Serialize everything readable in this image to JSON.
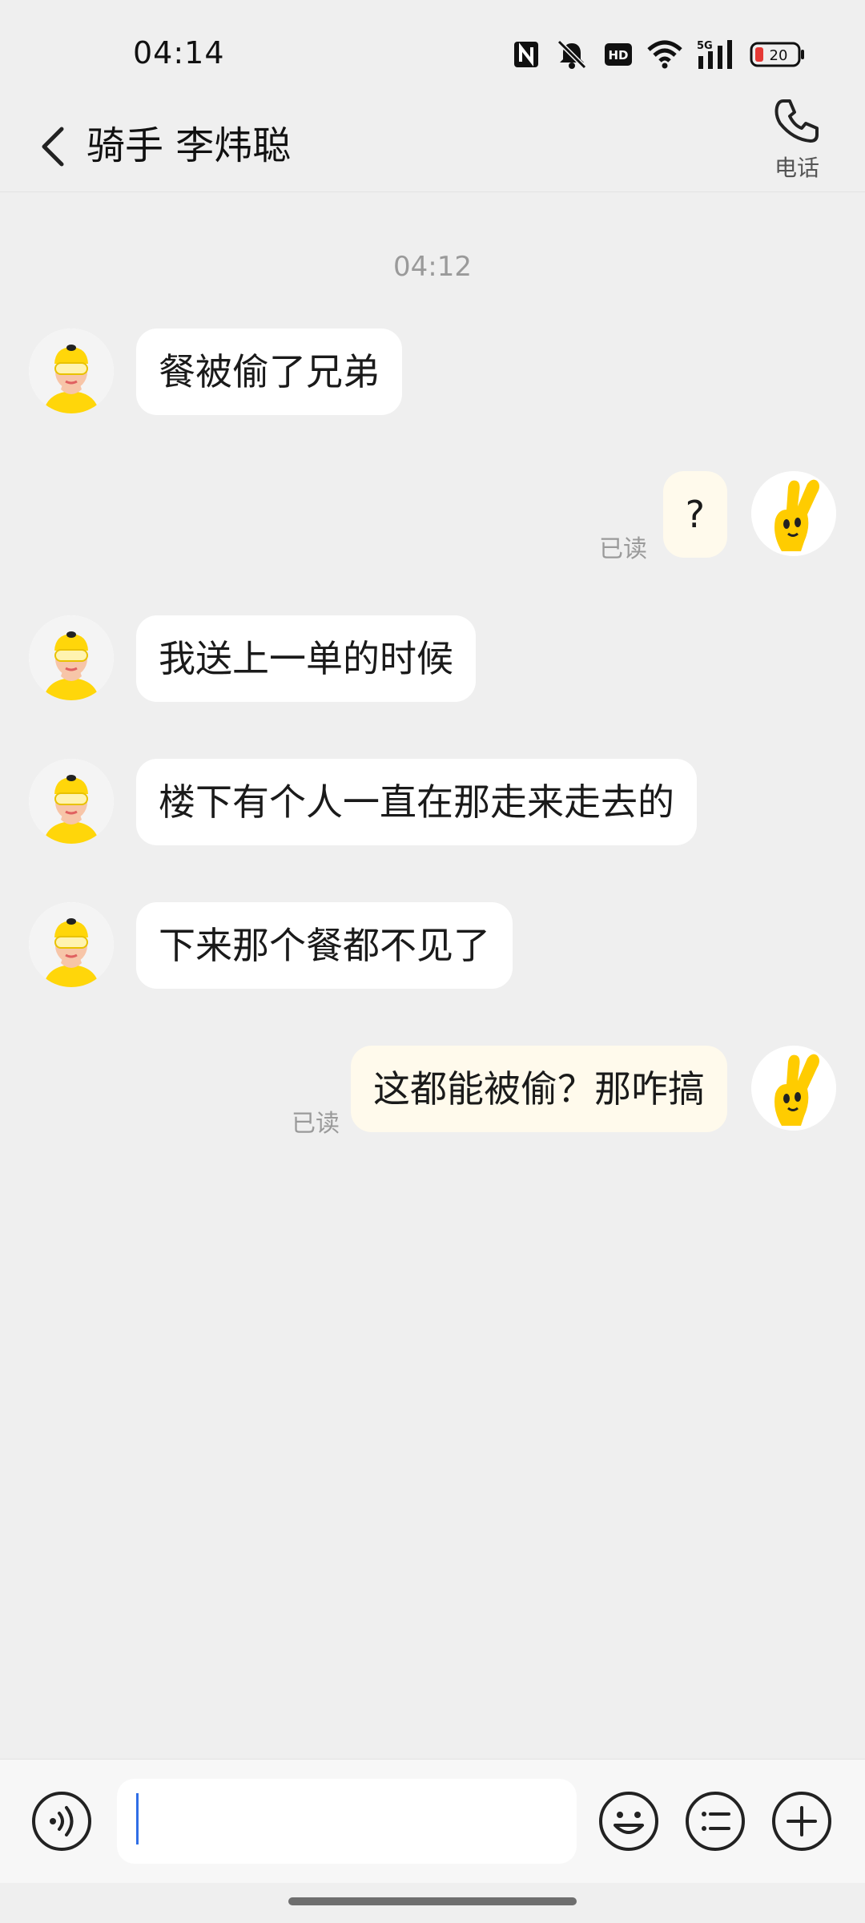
{
  "status_bar": {
    "time": "04:14",
    "battery_level": "20",
    "network_label": "5G",
    "hd_label": "HD",
    "icons": [
      "nfc-icon",
      "mute-icon",
      "hd-icon",
      "wifi-icon",
      "5g-signal-icon",
      "battery-icon"
    ],
    "battery_color": "#e53935"
  },
  "header": {
    "title": "骑手 李炜聪",
    "call_label": "电话"
  },
  "chat": {
    "timestamp": "04:12",
    "messages": [
      {
        "from": "rider",
        "text": "餐被偷了兄弟"
      },
      {
        "from": "me",
        "text": "?",
        "status": "已读"
      },
      {
        "from": "rider",
        "text": "我送上一单的时候"
      },
      {
        "from": "rider",
        "text": "楼下有个人一直在那走来走去的"
      },
      {
        "from": "rider",
        "text": "下来那个餐都不见了"
      },
      {
        "from": "me",
        "text": "这都能被偷？那咋搞",
        "status": "已读"
      }
    ]
  },
  "input_bar": {
    "value": ""
  },
  "colors": {
    "background": "#efefef",
    "incoming_bubble": "#ffffff",
    "outgoing_bubble": "#fffaec",
    "rider_helmet": "#ffd60a",
    "caret": "#2f6ee6"
  }
}
